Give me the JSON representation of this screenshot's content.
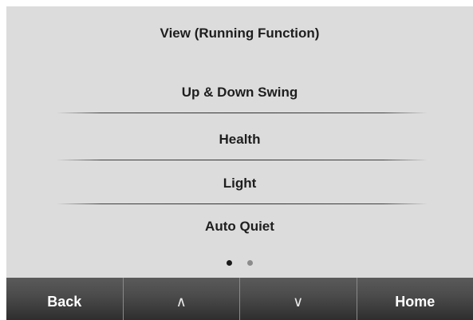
{
  "screen": {
    "title": "View (Running Function)"
  },
  "menu": {
    "items": [
      {
        "label": "Up & Down Swing"
      },
      {
        "label": "Health"
      },
      {
        "label": "Light"
      },
      {
        "label": "Auto Quiet"
      }
    ]
  },
  "pagination": {
    "current_page": 1,
    "total_pages": 2
  },
  "buttons": {
    "back_label": "Back",
    "up_label": "∧",
    "down_label": "∨",
    "home_label": "Home"
  },
  "colors": {
    "screen_background": "#dcdcdc",
    "text": "#1e1e1e",
    "button_bar": "#3c3c3c",
    "active_dot": "#1a1a1a",
    "inactive_dot": "#8c8c8c"
  }
}
